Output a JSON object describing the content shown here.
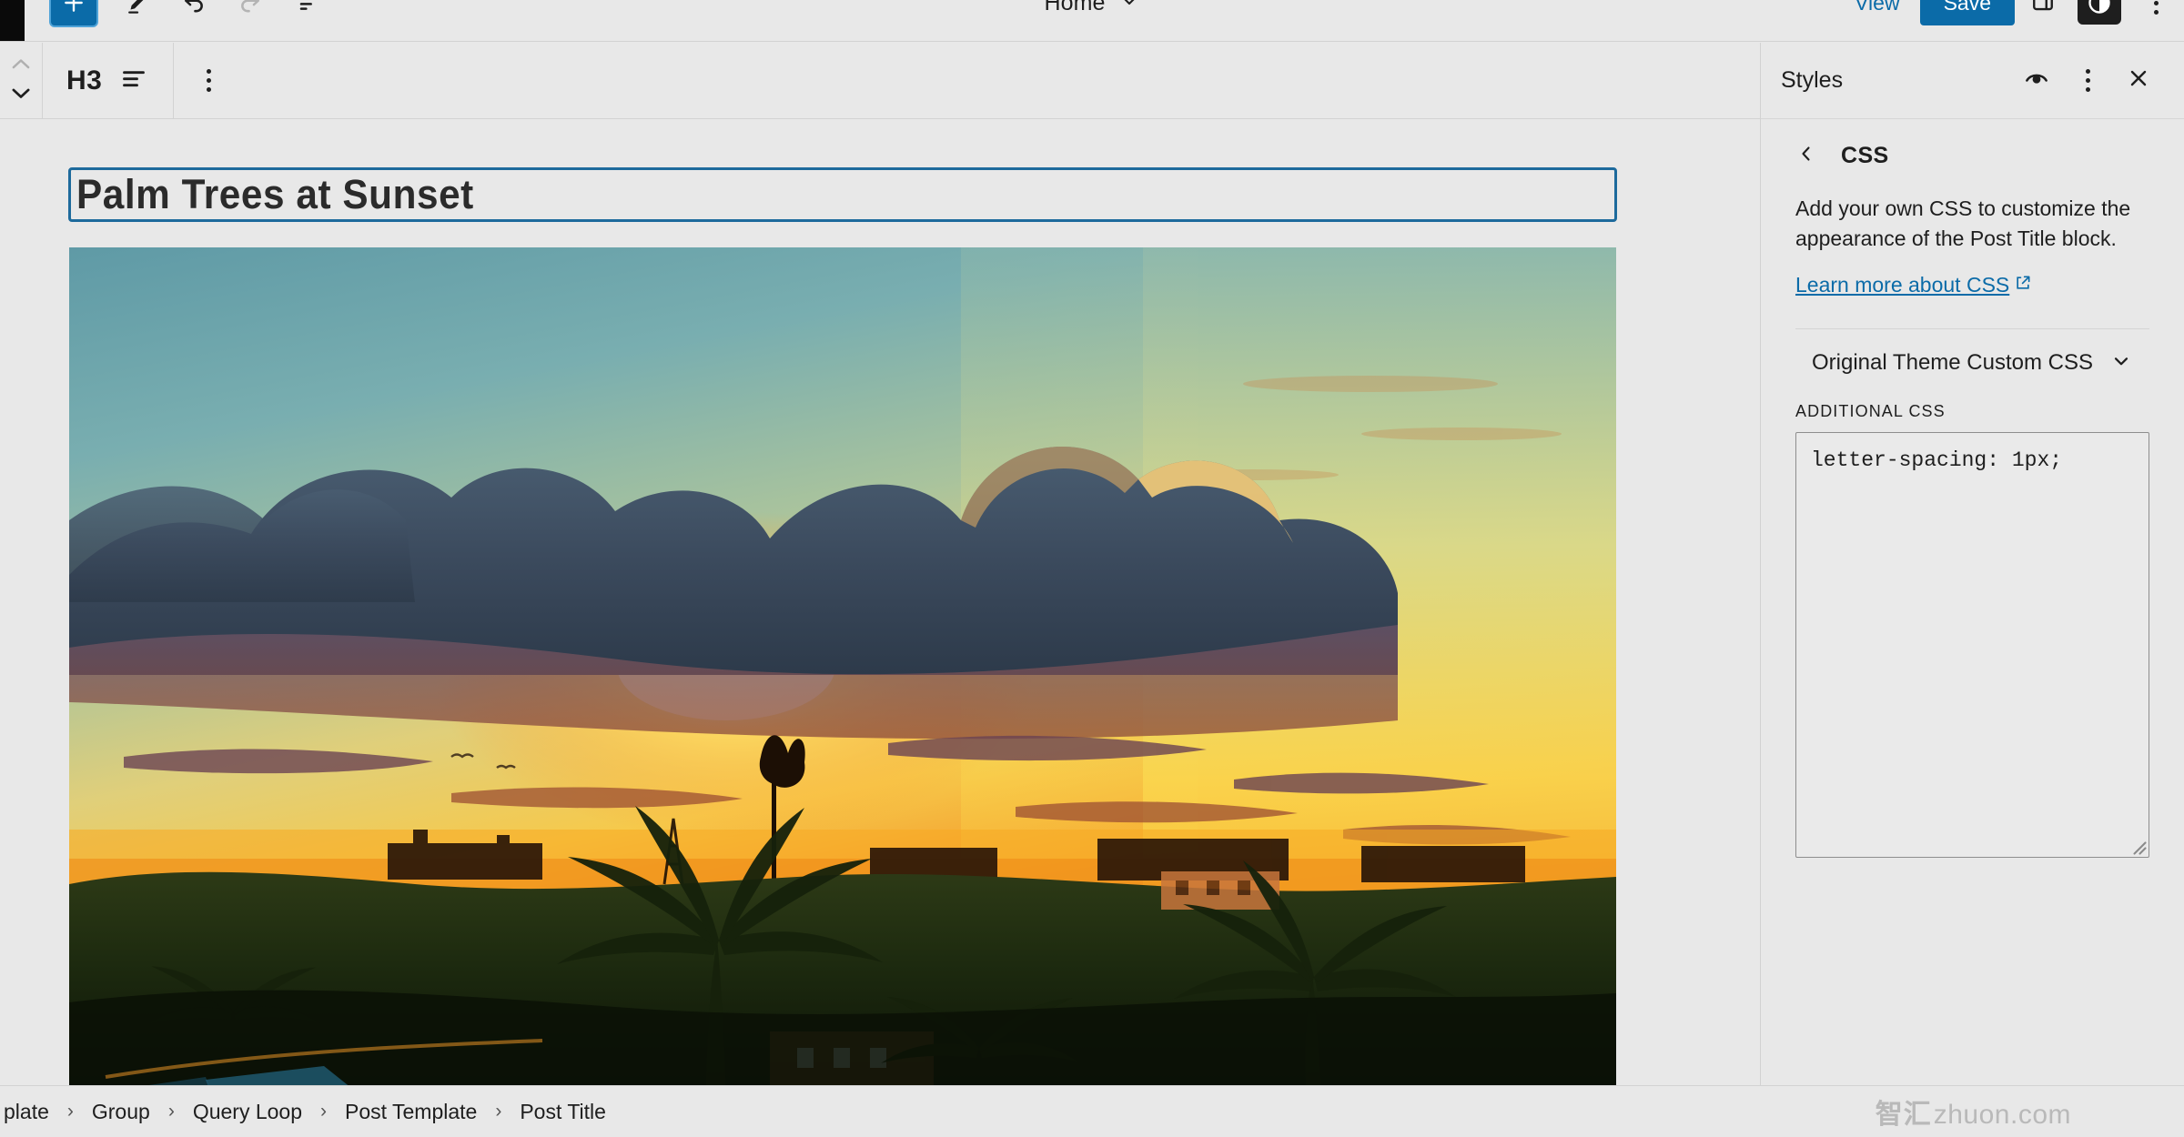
{
  "topbar": {
    "document_title": "Home",
    "document_title_caret_icon": "chevron-down-icon",
    "add_block_icon": "plus-icon",
    "tools_icon": "pencil-icon",
    "undo_icon": "undo-arrow-icon",
    "redo_icon": "redo-arrow-icon",
    "list_view_icon": "list-view-icon",
    "view_label": "View",
    "save_label": "Save",
    "sidebar_toggle_icon": "panel-layout-icon",
    "styles_toggle_icon": "contrast-circle-icon",
    "options_icon": "kebab-menu-icon",
    "site_hub_icon": "wordpress-hub-icon"
  },
  "block_toolbar": {
    "move_up_icon": "chevron-up-icon",
    "move_down_icon": "chevron-down-icon",
    "block_type_label": "H3",
    "align_icon": "align-left-icon",
    "more_options_icon": "kebab-menu-icon"
  },
  "canvas": {
    "post_title": "Palm Trees at Sunset",
    "featured_image_alt": "Sunset over palm tree canopy with dramatic clouds"
  },
  "breadcrumb": {
    "items": [
      "plate",
      "Group",
      "Query Loop",
      "Post Template",
      "Post Title"
    ],
    "separator": "›"
  },
  "watermark": {
    "cjk": "智汇",
    "latin": "zhuon.com"
  },
  "sidebar": {
    "title": "Styles",
    "preview_icon": "eye-icon",
    "more_icon": "kebab-menu-icon",
    "close_icon": "close-x-icon",
    "back_icon": "chevron-left-icon",
    "panel_title": "CSS",
    "help_text": "Add your own CSS to customize the appearance of the Post Title block.",
    "learn_more_label": "Learn more about CSS",
    "learn_more_icon": "external-link-icon",
    "accordion": {
      "label": "Original Theme Custom CSS",
      "caret_icon": "chevron-down-icon"
    },
    "additional_css_label": "ADDITIONAL CSS",
    "css_value": "letter-spacing: 1px;",
    "resize_icon": "resize-grip-icon"
  },
  "colors": {
    "accent": "#0b6ba8",
    "selection_border": "#1d6a9c",
    "chrome": "#e8e8e8",
    "border": "#d2d2d2",
    "text": "#1e1e1e"
  }
}
